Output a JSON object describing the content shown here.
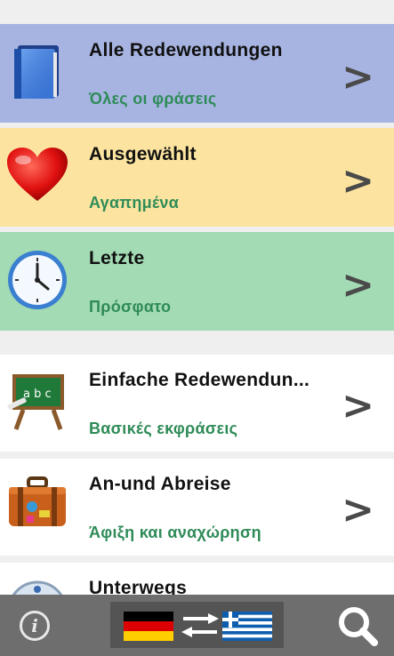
{
  "menu": {
    "items": [
      {
        "title": "Alle Redewendungen",
        "subtitle": "Όλες οι φράσεις",
        "icon": "book-icon",
        "bg": "#a7b4e1",
        "chevron": ">"
      },
      {
        "title": "Ausgewählt",
        "subtitle": "Αγαπημένα",
        "icon": "heart-icon",
        "bg": "#fce4a0",
        "chevron": ">"
      },
      {
        "title": "Letzte",
        "subtitle": "Πρόσφατο",
        "icon": "clock-icon",
        "bg": "#a3dbb4",
        "chevron": ">"
      }
    ]
  },
  "categories": {
    "items": [
      {
        "title": "Einfache Redewendun...",
        "subtitle": "Βασικές εκφράσεις",
        "icon": "chalkboard-icon",
        "bg": "#ffffff",
        "chevron": ">"
      },
      {
        "title": "An-und Abreise",
        "subtitle": "Άφιξη και αναχώρηση",
        "icon": "suitcase-icon",
        "bg": "#ffffff",
        "chevron": ">"
      },
      {
        "title": "Unterwegs",
        "subtitle": "",
        "icon": "compass-icon",
        "bg": "#ffffff",
        "chevron": ""
      }
    ]
  },
  "bottom_bar": {
    "info_label": "i",
    "info_icon": "info-icon",
    "language_switch_icon": "german-greek-flags-swap-icon",
    "search_icon": "search-icon",
    "bg": "#6e6e6e"
  }
}
